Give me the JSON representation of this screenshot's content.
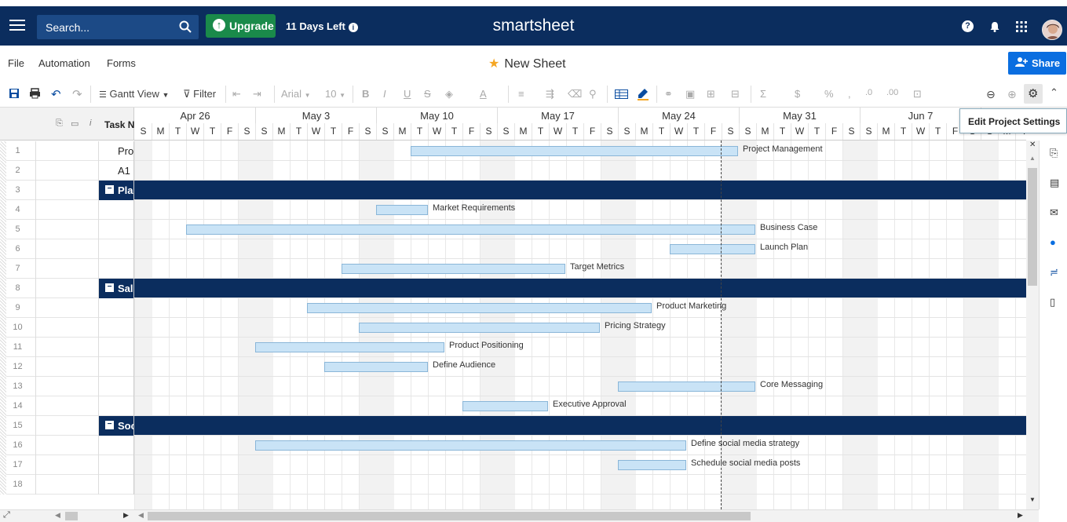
{
  "header": {
    "search_placeholder": "Search...",
    "upgrade_label": "Upgrade",
    "trial_text": "11 Days Left",
    "brand": "smartsheet"
  },
  "menu": {
    "file": "File",
    "automation": "Automation",
    "forms": "Forms",
    "sheet_title": "New Sheet",
    "share_label": "Share"
  },
  "toolbar": {
    "view": "Gantt View",
    "filter": "Filter",
    "font": "Arial",
    "font_size": "10"
  },
  "tooltip": "Edit Project Settings",
  "grid": {
    "task_column": "Task Name"
  },
  "gantt": {
    "weeks": [
      "Apr 26",
      "May 3",
      "May 10",
      "May 17",
      "May 24",
      "May 31",
      "Jun 7"
    ],
    "day_letters": [
      "S",
      "M",
      "T",
      "W",
      "T",
      "F",
      "S"
    ]
  },
  "rows": [
    {
      "num": "1",
      "task": "Project Management",
      "parent": false,
      "bar_label": "Project Management"
    },
    {
      "num": "2",
      "task": "A1",
      "parent": false,
      "bar_label": ""
    },
    {
      "num": "3",
      "task": "Plan",
      "parent": true,
      "bar_label": ""
    },
    {
      "num": "4",
      "task": "",
      "parent": false,
      "bar_label": "Market Requirements"
    },
    {
      "num": "5",
      "task": "",
      "parent": false,
      "bar_label": "Business Case"
    },
    {
      "num": "6",
      "task": "",
      "parent": false,
      "bar_label": "Launch Plan"
    },
    {
      "num": "7",
      "task": "",
      "parent": false,
      "bar_label": "Target Metrics"
    },
    {
      "num": "8",
      "task": "Sales",
      "parent": true,
      "bar_label": ""
    },
    {
      "num": "9",
      "task": "",
      "parent": false,
      "bar_label": "Product Marketing"
    },
    {
      "num": "10",
      "task": "",
      "parent": false,
      "bar_label": "Pricing Strategy"
    },
    {
      "num": "11",
      "task": "",
      "parent": false,
      "bar_label": "Product Positioning"
    },
    {
      "num": "12",
      "task": "",
      "parent": false,
      "bar_label": "Define Audience"
    },
    {
      "num": "13",
      "task": "",
      "parent": false,
      "bar_label": "Core Messaging"
    },
    {
      "num": "14",
      "task": "",
      "parent": false,
      "bar_label": "Executive Approval"
    },
    {
      "num": "15",
      "task": "Social",
      "parent": true,
      "bar_label": ""
    },
    {
      "num": "16",
      "task": "",
      "parent": false,
      "bar_label": "Define social media strategy"
    },
    {
      "num": "17",
      "task": "",
      "parent": false,
      "bar_label": "Schedule social media posts"
    },
    {
      "num": "18",
      "task": "",
      "parent": false,
      "bar_label": ""
    }
  ],
  "colors": {
    "navy": "#0b2d5e",
    "upgrade_green": "#1a8a4a",
    "share_blue": "#0a6ee0",
    "bar_fill": "#c9e3f6"
  }
}
